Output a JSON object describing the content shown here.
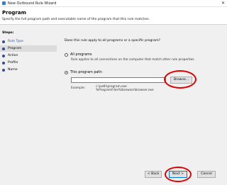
{
  "window": {
    "title": "New Outbound Rule Wizard",
    "close_glyph": "✕"
  },
  "header": {
    "title": "Program",
    "description": "Specify the full program path and executable name of the program that this rule matches."
  },
  "steps": {
    "label": "Steps:",
    "items": [
      {
        "label": "Rule Type",
        "state": "done"
      },
      {
        "label": "Program",
        "state": "active"
      },
      {
        "label": "Action",
        "state": "pending"
      },
      {
        "label": "Profile",
        "state": "pending"
      },
      {
        "label": "Name",
        "state": "pending"
      }
    ]
  },
  "main": {
    "question": "Does this rule apply to all programs or a specific program?",
    "all_programs": {
      "label": "All programs",
      "description": "Rule applies to all connections on the computer that match other rule properties.",
      "selected": false
    },
    "this_program": {
      "label": "This program path:",
      "selected": true
    },
    "path_input": {
      "value": "",
      "placeholder": ""
    },
    "browse_label": "Browse...",
    "example_label": "Example:",
    "example_line1": "c:\\path\\program.exe",
    "example_line2": "%ProgramFiles%\\browser\\browser.exe"
  },
  "footer": {
    "back_label": "< Back",
    "next_label": "Next >",
    "cancel_label": "Cancel"
  },
  "colors": {
    "accent": "#0078d7",
    "annotation": "#e00000",
    "step_dot": "#2b4e9b"
  }
}
